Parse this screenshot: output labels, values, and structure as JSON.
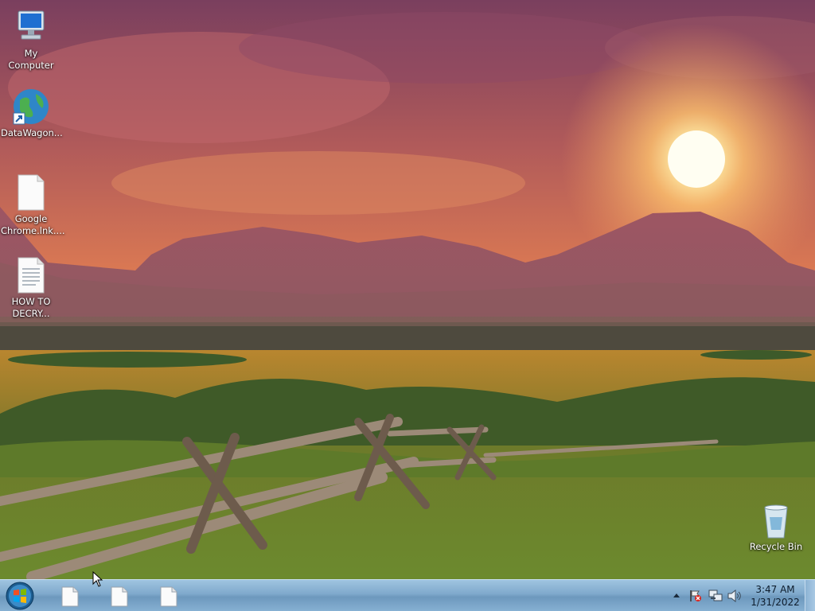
{
  "desktop": {
    "icons": [
      {
        "label": "My Computer",
        "icon": "computer-icon"
      },
      {
        "label": "DataWagon...",
        "icon": "globe-shortcut-icon"
      },
      {
        "label": "Google Chrome.lnk....",
        "icon": "document-icon"
      },
      {
        "label": "HOW TO DECRY...",
        "icon": "text-document-icon"
      },
      {
        "label": "Recycle Bin",
        "icon": "recycle-bin-icon"
      }
    ]
  },
  "taskbar": {
    "start_icon": "windows-start-orb-icon",
    "buttons": [
      {
        "icon": "document-icon"
      },
      {
        "icon": "document-icon"
      },
      {
        "icon": "document-icon"
      }
    ],
    "tray": {
      "icons": [
        "show-hidden-icons-arrow",
        "action-center-flag-icon",
        "network-icon",
        "volume-icon"
      ]
    },
    "clock": {
      "time": "3:47 AM",
      "date": "1/31/2022"
    }
  }
}
